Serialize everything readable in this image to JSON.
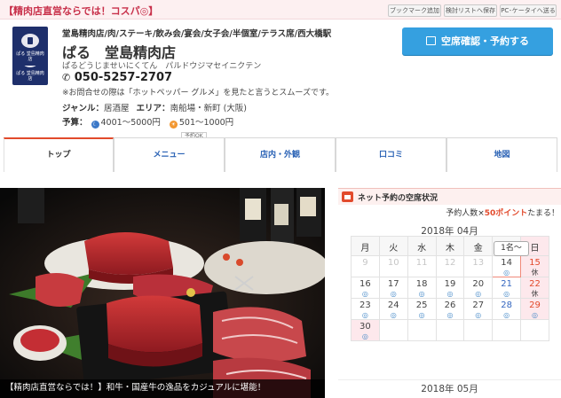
{
  "top": {
    "catch": "【精肉店直営ならでは！コスパ◎】",
    "util_links": [
      "ブックマーク追加",
      "検討リストへ保存",
      "PC･ケータイへ送る"
    ]
  },
  "header": {
    "logo_text": "ぱる 堂島精肉店",
    "genre": "堂島精肉店/肉/ステーキ/飲み会/宴会/女子会/半個室/テラス席/西大橋駅",
    "name": "ぱる　堂島精肉店",
    "kana": "ぱるどうじませいにくてん　パルドウジマセイニクテン",
    "phone": "050-5257-2707",
    "phone_note": "※お問合せの際は「ホットペッパー グルメ」を見たと言うとスムーズです。",
    "genre_label": "ジャンル：",
    "genre_value": "居酒屋",
    "area_label": "エリア：",
    "area_value": "南船場・新町 (大阪)",
    "budget_label": "予算：",
    "budget_dinner": "4001～5000円",
    "budget_lunch": "501～1000円",
    "reserve_button": "空席確認・予約する"
  },
  "tabs": {
    "yoyaku_ok": "予約OK",
    "items": [
      "トップ",
      "メニュー",
      "店内・外観",
      "口コミ",
      "地図"
    ]
  },
  "photo": {
    "caption": "【精肉店直営ならでは！】和牛・国産牛の逸品をカジュアルに堪能！"
  },
  "side": {
    "title": "ネット予約の空席状況",
    "sub_prefix": "予約人数×",
    "sub_points": "50ポイント",
    "sub_suffix": "たまる！",
    "month1": "2018年 04月",
    "month2": "2018年 05月",
    "people": "1名～",
    "weekdays": [
      "月",
      "火",
      "水",
      "木",
      "金",
      "土",
      "日"
    ],
    "weeks": [
      [
        {
          "d": "9",
          "m": ""
        },
        {
          "d": "10",
          "m": ""
        },
        {
          "d": "11",
          "m": ""
        },
        {
          "d": "12",
          "m": ""
        },
        {
          "d": "13",
          "m": ""
        },
        {
          "d": "14",
          "m": "◎"
        },
        {
          "d": "15",
          "m": "休"
        }
      ],
      [
        {
          "d": "16",
          "m": "◎"
        },
        {
          "d": "17",
          "m": "◎"
        },
        {
          "d": "18",
          "m": "◎"
        },
        {
          "d": "19",
          "m": "◎"
        },
        {
          "d": "20",
          "m": "◎"
        },
        {
          "d": "21",
          "m": "◎"
        },
        {
          "d": "22",
          "m": "休"
        }
      ],
      [
        {
          "d": "23",
          "m": "◎"
        },
        {
          "d": "24",
          "m": "◎"
        },
        {
          "d": "25",
          "m": "◎"
        },
        {
          "d": "26",
          "m": "◎"
        },
        {
          "d": "27",
          "m": "◎"
        },
        {
          "d": "28",
          "m": "◎"
        },
        {
          "d": "29",
          "m": "◎"
        }
      ],
      [
        {
          "d": "30",
          "m": "◎"
        },
        {
          "d": "",
          "m": ""
        },
        {
          "d": "",
          "m": ""
        },
        {
          "d": "",
          "m": ""
        },
        {
          "d": "",
          "m": ""
        },
        {
          "d": "",
          "m": ""
        },
        {
          "d": "",
          "m": ""
        }
      ]
    ]
  },
  "colors": {
    "accent": "#e24a2c",
    "button": "#35a0e0",
    "link": "#2a62b5",
    "catch_text": "#c8304a"
  }
}
